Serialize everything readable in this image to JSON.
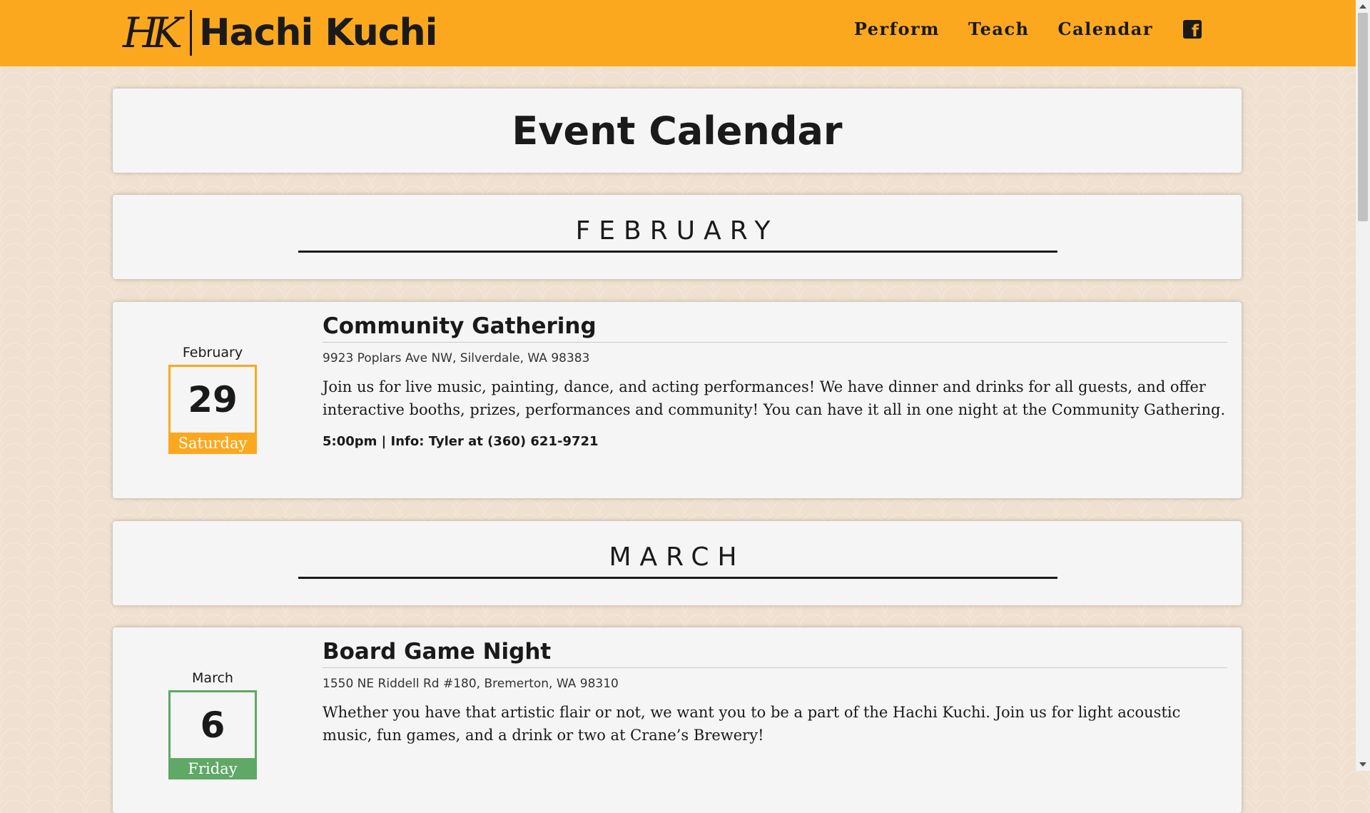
{
  "header": {
    "logo_mark": "HK",
    "logo_text": "Hachi Kuchi",
    "nav": [
      "Perform",
      "Teach",
      "Calendar"
    ],
    "brand_color": "#fca81e",
    "social_icon": "facebook-icon"
  },
  "page": {
    "title": "Event Calendar"
  },
  "months": [
    {
      "name": "FEBRUARY",
      "event": {
        "month": "February",
        "day_number": "29",
        "weekday": "Saturday",
        "accent_color": "#fca81e",
        "title": "Community Gathering",
        "address": "9923 Poplars Ave NW, Silverdale, WA 98383",
        "description": "Join us for live music, painting, dance, and acting performances! We have dinner and drinks for all guests, and offer interactive booths, prizes, performances and community! You can have it all in one night at the Community Gathering.",
        "info": "5:00pm | Info: Tyler at (360) 621-9721"
      }
    },
    {
      "name": "MARCH",
      "event": {
        "month": "March",
        "day_number": "6",
        "weekday": "Friday",
        "accent_color": "#5fa866",
        "title": "Board Game Night",
        "address": "1550 NE Riddell Rd #180, Bremerton, WA 98310",
        "description": "Whether you have that artistic flair or not, we want you to be a part of the Hachi Kuchi. Join us for light acoustic music, fun games, and a drink or two at Crane’s Brewery!"
      }
    }
  ]
}
